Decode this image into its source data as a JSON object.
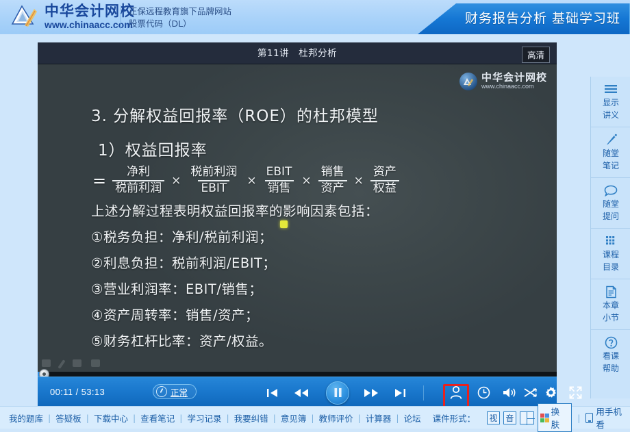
{
  "header": {
    "logo_cn": "中华会计网校",
    "logo_url": "www.chinaacc.com",
    "sub_line1": "正保远程教育旗下品牌网站",
    "sub_line2": "股票代码（DL）",
    "banner_title": "财务报告分析 基础学习班"
  },
  "player": {
    "video_title": "第11讲　杜邦分析",
    "hd_badge": "高清",
    "watermark_cn": "中华会计网校",
    "watermark_url": "www.chinaacc.com",
    "time_current": "00:11",
    "time_separator": "/",
    "time_total": "53:13",
    "time_label": "00:11  /  53:13",
    "speed_label": "正常",
    "progress_percent": 0.35
  },
  "slide": {
    "heading1": "3. 分解权益回报率（ROE）的杜邦模型",
    "heading2": "1）权益回报率",
    "formula": {
      "equals": "=",
      "times": "×",
      "terms": [
        {
          "num": "净利",
          "den": "税前利润"
        },
        {
          "num": "税前利润",
          "den": "EBIT"
        },
        {
          "num": "EBIT",
          "den": "销售"
        },
        {
          "num": "销售",
          "den": "资产"
        },
        {
          "num": "资产",
          "den": "权益"
        }
      ]
    },
    "intro": "上述分解过程表明权益回报率的影响因素包括：",
    "items": [
      "①税务负担：净利/税前利润；",
      "②利息负担：税前利润/EBIT；",
      "③营业利润率：EBIT/销售；",
      "④资产周转率：销售/资产；",
      "⑤财务杠杆比率：资产/权益。"
    ]
  },
  "sidebar": {
    "items": [
      {
        "icon": "menu-icon",
        "line1": "显示",
        "line2": "讲义"
      },
      {
        "icon": "pencil-icon",
        "line1": "随堂",
        "line2": "笔记"
      },
      {
        "icon": "comment-icon",
        "line1": "随堂",
        "line2": "提问"
      },
      {
        "icon": "grid-icon",
        "line1": "课程",
        "line2": "目录"
      },
      {
        "icon": "document-icon",
        "line1": "本章",
        "line2": "小节"
      },
      {
        "icon": "help-icon",
        "line1": "看课",
        "line2": "帮助"
      }
    ]
  },
  "footer": {
    "links": [
      "我的题库",
      "答疑板",
      "下载中心",
      "查看笔记",
      "学习记录",
      "我要纠错",
      "意见簿",
      "教师评价",
      "计算器",
      "论坛"
    ],
    "separator": "|",
    "format_label": "课件形式：",
    "format_video": "视",
    "format_audio": "音",
    "format_split": "split-view-icon",
    "skin_label": "换肤",
    "phone_label": "用手机看"
  },
  "colors": {
    "header_blue": "#a9d2f9",
    "banner_blue": "#1577d4",
    "control_blue": "#1a78cd",
    "video_dark": "#3b4548",
    "title_dark": "#242c3c",
    "link_blue": "#1b5ea6",
    "highlight_red": "#e8221f",
    "cursor_yellow": "#e3e83a"
  }
}
